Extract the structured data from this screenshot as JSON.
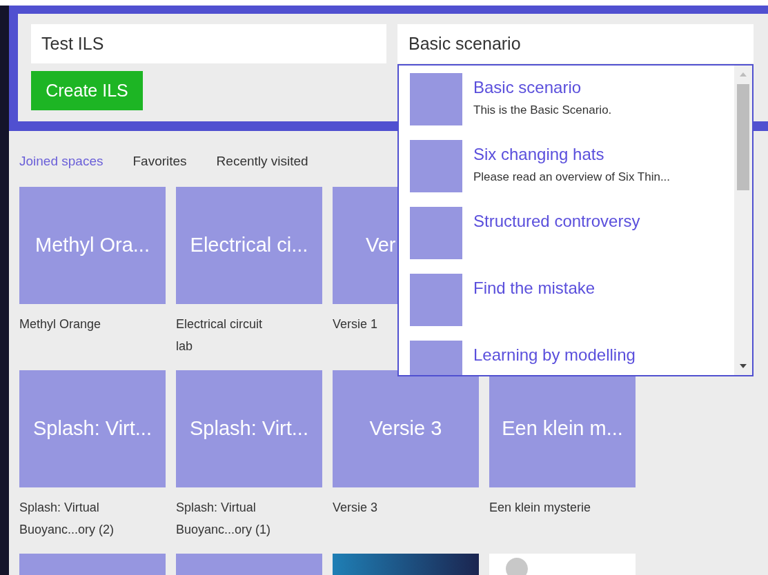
{
  "header": {
    "name_field": {
      "value": "Test ILS"
    },
    "scenario_field": {
      "value": "Basic scenario"
    },
    "create_button": "Create ILS"
  },
  "scenario_dropdown": {
    "expanded": true,
    "items": [
      {
        "title": "Basic scenario",
        "description": "This is the Basic Scenario."
      },
      {
        "title": "Six changing hats",
        "description": "Please read an overview of Six Thin..."
      },
      {
        "title": "Structured controversy"
      },
      {
        "title": "Find the mistake"
      },
      {
        "title": "Learning by modelling"
      }
    ]
  },
  "tabs": [
    {
      "label": "Joined spaces",
      "selected": true
    },
    {
      "label": "Favorites",
      "selected": false
    },
    {
      "label": "Recently visited",
      "selected": false
    }
  ],
  "spaces": [
    {
      "kind": "tile",
      "title": "Methyl Ora...",
      "caption": "Methyl Orange"
    },
    {
      "kind": "tile",
      "title": "Electrical ci...",
      "caption": "Electrical circuit lab"
    },
    {
      "kind": "tile",
      "title": "Ver",
      "title_cut": true,
      "caption": "Versie 1"
    },
    {
      "kind": "hidden"
    },
    {
      "kind": "tile",
      "title": "Splash: Virt...",
      "caption": "Splash: Virtual Buoyanc...ory (2)"
    },
    {
      "kind": "tile",
      "title": "Splash: Virt...",
      "caption": "Splash: Virtual Buoyanc...ory (1)"
    },
    {
      "kind": "tile",
      "title": "Versie 3",
      "caption": "Versie 3"
    },
    {
      "kind": "tile",
      "title": "Een klein m...",
      "caption": "Een klein mysterie"
    },
    {
      "kind": "plain"
    },
    {
      "kind": "plain"
    },
    {
      "kind": "picture"
    },
    {
      "kind": "picture"
    }
  ]
}
